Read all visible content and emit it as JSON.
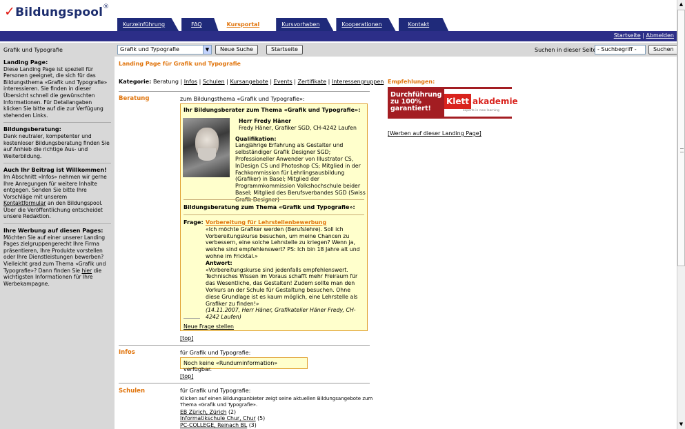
{
  "header": {
    "logo_check": "✓",
    "logo_text": "Bildungspool",
    "logo_reg": "®",
    "tabs": [
      {
        "label": "Kurzeinführung"
      },
      {
        "label": "FAQ"
      },
      {
        "label": "Kursportal"
      },
      {
        "label": "Kursvorhaben"
      },
      {
        "label": "Kooperationen"
      },
      {
        "label": "Kontakt"
      }
    ],
    "active_tab": "Kursportal",
    "links": {
      "startseite": "Startseite",
      "separator": "|",
      "abmelden": "Abmelden"
    }
  },
  "searchbar": {
    "category_label": "Grafik und Typografie",
    "category_select": "Grafik und Typografie",
    "new_search_button": "Neue Suche",
    "start_button": "Startseite",
    "search_label": "Suchen in dieser Seite:",
    "search_value": "- Suchbegriff -",
    "search_button": "Suchen"
  },
  "sidebar": {
    "blocks": [
      {
        "title": "Landing Page:",
        "text": "Diese Landing Page ist speziell für Personen geeignet, die sich für das Bildungsthema «Grafik und Typografie» interessieren. Sie finden in dieser Übersicht schnell die gewünschten Informationen. Für Detailangaben klicken Sie bitte auf die zur Verfügung stehenden Links."
      },
      {
        "title": "Bildungsberatung:",
        "text": "Dank neutraler, kompetenter und kostenloser Bildungsberatung finden Sie auf Anhieb die richtige Aus- und Weiterbildung."
      },
      {
        "title": "Auch Ihr Beitrag ist Willkommen!",
        "text_pre": "Im Abschnitt «Infos» nehmen wir gerne Ihre Anregungen für weitere Inhalte entgegen. Senden Sie bitte Ihre Vorschläge mit unserem ",
        "link": "Kontaktformular",
        "text_post": " an den Bildungspool. Über die Veröffentlichung entscheidet unsere Redaktion."
      },
      {
        "title": "Ihre Werbung auf diesen Pages:",
        "text_pre": "Möchten Sie auf einer unserer Landing Pages zielgruppengerecht Ihre Firma präsentieren, Ihre Produkte vorstellen oder Ihre Dienstleistungen bewerben? Vielleicht grad zum Thema «Grafik und Typografie»? Dann finden Sie ",
        "link": "hier",
        "text_post": " die wichtigsten Informationen für Ihre Werbekampagne."
      }
    ]
  },
  "main": {
    "title": "Landing Page für Grafik und Typografie",
    "kategorie_label": "Kategorie:",
    "kategorie_current": "Beratung",
    "kategorie_links": [
      "Infos",
      "Schulen",
      "Kursangebote",
      "Events",
      "Zertifikate",
      "Interessengruppen"
    ],
    "sep": "|",
    "beratung": {
      "label": "Beratung",
      "desc": "zum Bildungsthema «Grafik und Typografie»:",
      "box_title": "Ihr Bildungsberater zum Thema «Grafik und Typografie»:",
      "name": "Herr Fredy Häner",
      "company": "Fredy Häner, Grafiker SGD, CH-4242 Laufen",
      "qual_label": "Qualifikation:",
      "qual_text": "Langjährige Erfahrung als Gestalter und selbständiger Grafik Designer SGD; Professioneller Anwender von Illustrator CS, InDesign CS und Photoshop CS; Mitglied in der Fachkommission für Lehrlingsausbildung (Grafiker) in Basel; Mitglied der Programmkommission Volkshochschule beider Basel; Mitglied des Berufsverbandes SGD (Swiss Grafik Designer)",
      "box_title2": "Bildungsberatung zum Thema «Grafik und Typografie»:",
      "frage_label": "Frage:",
      "frage_title": "Vorbereitung für Lehrstellenbewerbung",
      "frage_text": "«Ich möchte Grafiker werden (Berufslehre). Soll ich Vorbereitungskurse besuchen, um meine Chancen zu verbessern, eine solche Lehrstelle zu kriegen? Wenn ja, welche sind empfehlenswert? PS: Ich bin 18 Jahre alt und wohne im Fricktal.»",
      "antwort_label": "Antwort:",
      "antwort_text": "«Vorbereitungskurse sind jedenfalls empfehlenswert. Technisches Wissen im Voraus schafft mehr Freiraum für das Wesentliche, das Gestalten! Zudem sollte man den Vorkurs an der Schule für Gestaltung besuchen. Ohne diese Grundlage ist es kaum möglich, eine Lehrstelle als Grafiker zu finden!»",
      "antwort_sig": "(14.11.2007, Herr Häner, Grafikatelier Häner Fredy, CH-4242 Laufen)",
      "neue_frage": "Neue Frage stellen",
      "top": "[top]"
    },
    "infos": {
      "label": "Infos",
      "desc": "für Grafik und Typografie:",
      "box_text": "Noch keine «Rundum­information» verfügbar.",
      "top": "[top]"
    },
    "schulen": {
      "label": "Schulen",
      "desc": "für Grafik und Typografie:",
      "intro": "Klicken auf einen Bildungsanbieter zeigt seine aktuellen Bildungsangebote zum Thema «Grafik und Typografie».",
      "items": [
        {
          "name": "EB Zürich, Zürich",
          "count": " (2)"
        },
        {
          "name": "Informatikschule Chur, Chur",
          "count": " (5)"
        },
        {
          "name": "PC-COLLEGE, Reinach BL",
          "count": " (3)"
        }
      ]
    }
  },
  "right": {
    "title": "Empfehlungen:",
    "ad_text": "Durchführung zu 100% garantiert!",
    "ad_brand_klett": "Klett",
    "ad_brand_akademie": "akademie",
    "ad_brand_sub": "experts in new learning",
    "werben": "[Werben auf dieser Landing Page]"
  },
  "colors": {
    "accent": "#e0730a",
    "nav": "#1f2a7a",
    "strip": "#2c2e88",
    "yellow": "#ffffcc",
    "sidebar": "#d8d8d8"
  }
}
